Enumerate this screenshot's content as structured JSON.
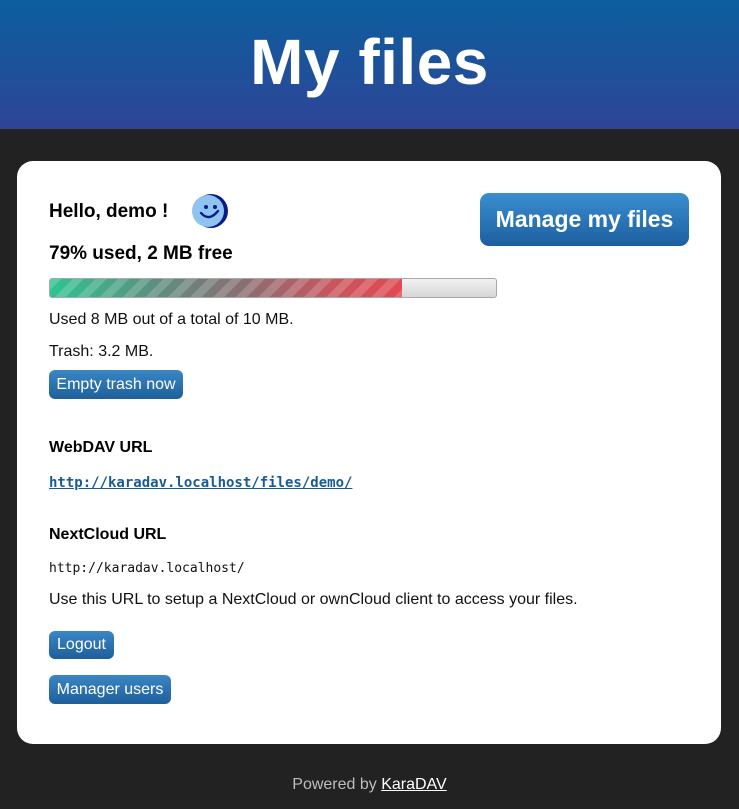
{
  "header": {
    "title": "My files"
  },
  "card": {
    "greeting": "Hello, demo !",
    "avatar_icon": "smiley-face-icon",
    "manage_button": "Manage my files",
    "usage_summary": "79% used, 2 MB free",
    "usage_fraction": 0.79,
    "usage_detail": "Used 8 MB out of a total of 10 MB.",
    "trash_text": "Trash: 3.2 MB.",
    "empty_trash_button": "Empty trash now",
    "webdav_label": "WebDAV URL",
    "webdav_url": "http://karadav.localhost/files/demo/",
    "nextcloud_label": "NextCloud URL",
    "nextcloud_url": "http://karadav.localhost/",
    "nextcloud_help": "Use this URL to setup a NextCloud or ownCloud client to access your files.",
    "logout_button": "Logout",
    "manage_users_button": "Manager users"
  },
  "footer": {
    "powered_by": "Powered by",
    "link_text": "KaraDAV"
  },
  "colors": {
    "header_top": "#0b5f9e",
    "header_bottom": "#2f4497",
    "page_background": "#222222",
    "button_blue": "#2a72b5",
    "link_blue": "#1a5a93",
    "bar_start": "#2ec490",
    "bar_end": "#e24952"
  }
}
